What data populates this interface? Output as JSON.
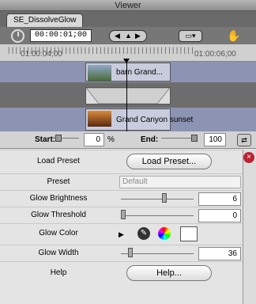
{
  "window": {
    "title": "Viewer"
  },
  "tab": {
    "label": "SE_DissolveGlow"
  },
  "toolbar": {
    "timecode": "00:00:01;00",
    "icons": {
      "stopwatch": "stopwatch-icon",
      "play": "play-segment-icons",
      "monitor": "monitor-icon",
      "hand": "hand-icon"
    }
  },
  "ruler": {
    "left_timecode": "01:00:04;00",
    "right_timecode": "01:00:06;00"
  },
  "clips": {
    "top": "barn Grand...",
    "bottom": "Grand Canyon sunset"
  },
  "range": {
    "start_label": "Start:",
    "start_value": "0",
    "percent": "%",
    "end_label": "End:",
    "end_value": "100"
  },
  "params": {
    "load_preset": {
      "label": "Load Preset",
      "button": "Load Preset..."
    },
    "preset": {
      "label": "Preset",
      "placeholder": "Default"
    },
    "glow_brightness": {
      "label": "Glow Brightness",
      "value": "6",
      "fraction": 0.6
    },
    "glow_threshold": {
      "label": "Glow Threshold",
      "value": "0",
      "fraction": 0.0
    },
    "glow_color": {
      "label": "Glow Color",
      "swatch": "#ffffff"
    },
    "glow_width": {
      "label": "Glow Width",
      "value": "36",
      "fraction": 0.1
    },
    "help": {
      "label": "Help",
      "button": "Help..."
    }
  },
  "colors": {
    "track_bg": "#8d93b2",
    "close": "#b23333"
  }
}
